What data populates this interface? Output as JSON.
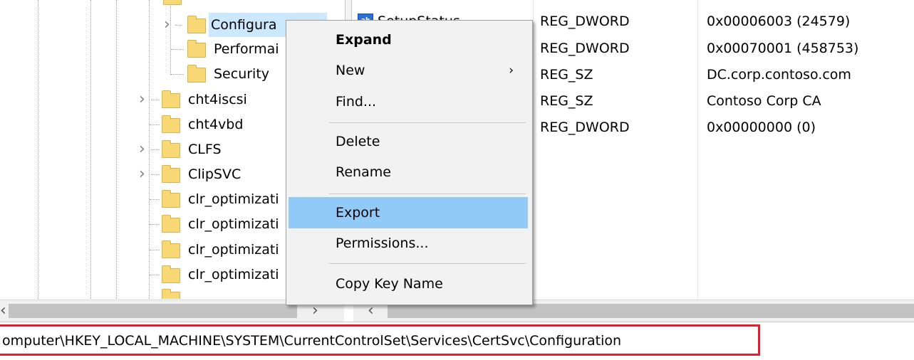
{
  "tree": {
    "selected": "Configuration",
    "child_nodes": [
      {
        "label": "Configura",
        "expandable": true,
        "selected": true
      },
      {
        "label": "Performai",
        "expandable": false,
        "selected": false
      },
      {
        "label": "Security",
        "expandable": false,
        "selected": false
      }
    ],
    "nodes": [
      {
        "label": "cht4iscsi",
        "expandable": true
      },
      {
        "label": "cht4vbd",
        "expandable": false
      },
      {
        "label": "CLFS",
        "expandable": true
      },
      {
        "label": "ClipSVC",
        "expandable": true
      },
      {
        "label": "clr_optimizati",
        "expandable": false
      },
      {
        "label": "clr_optimizati",
        "expandable": false
      },
      {
        "label": "clr_optimizati",
        "expandable": false
      },
      {
        "label": "clr_optimizati",
        "expandable": false
      }
    ]
  },
  "values": {
    "rows": [
      {
        "name": "SetupStatus",
        "type": "REG_DWORD",
        "data": "0x00006003 (24579)"
      },
      {
        "name": "",
        "type": "REG_DWORD",
        "data": "0x00070001 (458753)"
      },
      {
        "name": "",
        "type": "REG_SZ",
        "data": "DC.corp.contoso.com"
      },
      {
        "name": "",
        "type": "REG_SZ",
        "data": "Contoso Corp CA"
      },
      {
        "name": "",
        "type": "REG_DWORD",
        "data": "0x00000000 (0)"
      }
    ],
    "icon_text": "ab"
  },
  "context_menu": {
    "items": [
      {
        "label": "Expand",
        "bold": true,
        "submenu": false,
        "highlighted": false
      },
      {
        "label": "New",
        "bold": false,
        "submenu": true,
        "highlighted": false
      },
      {
        "label": "Find...",
        "bold": false,
        "submenu": false,
        "highlighted": false
      },
      {
        "label": "Delete",
        "bold": false,
        "submenu": false,
        "highlighted": false
      },
      {
        "label": "Rename",
        "bold": false,
        "submenu": false,
        "highlighted": false
      },
      {
        "label": "Export",
        "bold": false,
        "submenu": false,
        "highlighted": true
      },
      {
        "label": "Permissions...",
        "bold": false,
        "submenu": false,
        "highlighted": false
      },
      {
        "label": "Copy Key Name",
        "bold": false,
        "submenu": false,
        "highlighted": false
      }
    ],
    "submenu_arrow": "›"
  },
  "scrollbars": {
    "left_arrow": "‹",
    "right_arrow": "›"
  },
  "address_bar": {
    "path": "omputer\\HKEY_LOCAL_MACHINE\\SYSTEM\\CurrentControlSet\\Services\\CertSvc\\Configuration"
  },
  "colors": {
    "selection": "#cce8ff",
    "menu_highlight": "#91c9f7",
    "folder": "#f8d775",
    "address_outline": "#e0202e"
  }
}
